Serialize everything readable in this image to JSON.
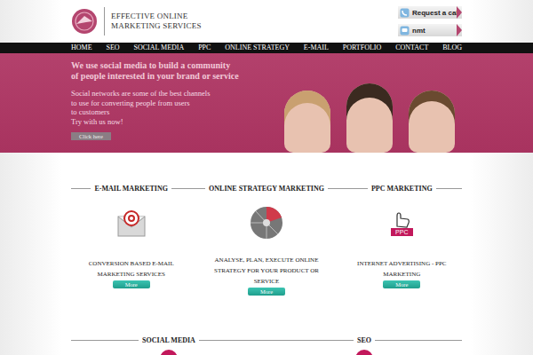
{
  "logo": {
    "line1": "EFFECTIVE ONLINE",
    "line2": "MARKETING SERVICES"
  },
  "header_buttons": [
    {
      "label": "Request a call"
    },
    {
      "label": "nmt"
    }
  ],
  "nav": [
    {
      "label": "HOME"
    },
    {
      "label": "SEO"
    },
    {
      "label": "SOCIAL MEDIA"
    },
    {
      "label": "PPC"
    },
    {
      "label": "ONLINE STRATEGY"
    },
    {
      "label": "E-MAIL"
    },
    {
      "label": "PORTFOLIO"
    },
    {
      "label": "CONTACT"
    },
    {
      "label": "BLOG"
    }
  ],
  "hero": {
    "headline": [
      "We use social media to build a community",
      "of people interested in your brand or service"
    ],
    "text": [
      "Social networks are some of the best channels",
      "to use for converting people from users",
      "to customers",
      "Try with us now!"
    ],
    "button": "Click here"
  },
  "services": [
    {
      "kind": "email",
      "title": "E-MAIL MARKETING",
      "description": "CONVERSION BASED E-MAIL MARKETING SERVICES",
      "button": "More",
      "icon_label": ""
    },
    {
      "kind": "strategy",
      "title": "ONLINE STRATEGY MARKETING",
      "description": "ANALYSE, PLAN, EXECUTE ONLINE STRATEGY FOR YOUR PRODUCT OR SERVICE",
      "button": "More",
      "icon_label": ""
    },
    {
      "kind": "ppc",
      "title": "PPC MARKETING",
      "description": "INTERNET ADVERTISING - PPC MARKETING",
      "button": "More",
      "icon_label": "PPC"
    }
  ],
  "lower_services": [
    {
      "title": "SOCIAL MEDIA"
    },
    {
      "title": "SEO"
    }
  ]
}
